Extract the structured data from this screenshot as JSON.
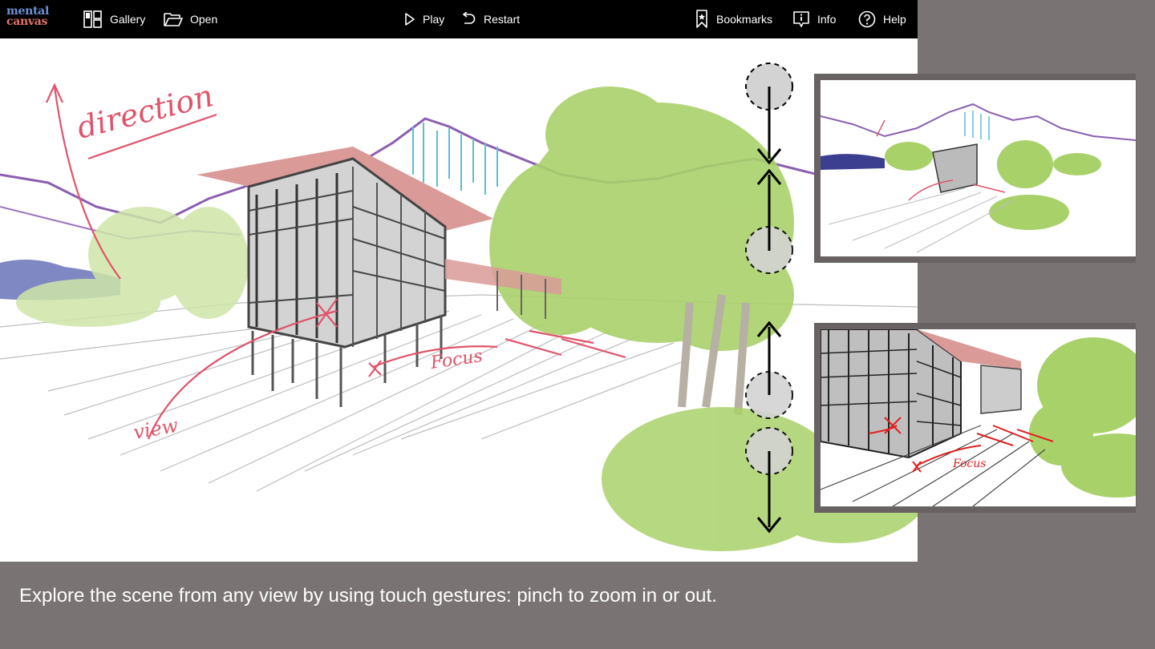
{
  "app": {
    "logo_line1": "mental",
    "logo_line2": "canvas"
  },
  "toolbar": {
    "gallery_label": "Gallery",
    "open_label": "Open",
    "play_label": "Play",
    "restart_label": "Restart",
    "bookmarks_label": "Bookmarks",
    "info_label": "Info",
    "help_label": "Help"
  },
  "sketch": {
    "annotation_direction": "direction",
    "annotation_view": "view",
    "annotation_focus": "Focus"
  },
  "thumbnails": {
    "close_focus_label": "Focus"
  },
  "caption": "Explore the scene from any view by using touch gestures: pinch to zoom in or out.",
  "colors": {
    "toolbar_bg": "#000000",
    "side_bg": "#7a7373",
    "canvas_bg": "#ffffff",
    "annotation_red": "#e0546a",
    "foliage_green": "#a9d16a",
    "mountain_purple": "#8a5fb0",
    "sky_blue": "#5fbcd6"
  },
  "icons": {
    "gallery": "gallery-grid-icon",
    "open": "folder-open-icon",
    "play": "play-icon",
    "restart": "restart-icon",
    "bookmarks": "bookmark-icon",
    "info": "info-icon",
    "help": "help-circle-icon"
  }
}
